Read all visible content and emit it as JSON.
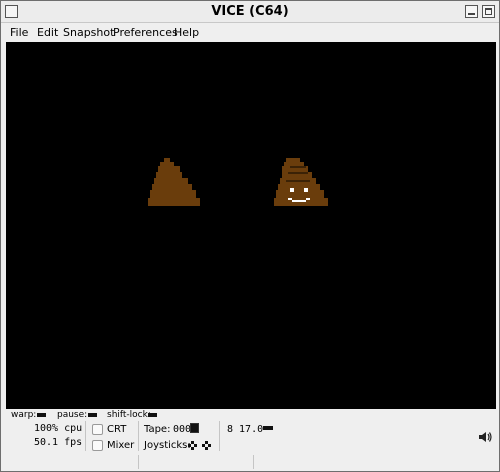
{
  "window": {
    "title": "VICE (C64)"
  },
  "menu": {
    "items": [
      "File",
      "Edit",
      "Snapshot",
      "Preferences",
      "Help"
    ]
  },
  "status": {
    "warp_label": "warp:",
    "pause_label": "pause:",
    "shift_lock_label": "shift-lock:",
    "cpu": "100% cpu",
    "fps": "50.1 fps",
    "crt_label": "CRT",
    "mixer_label": "Mixer",
    "tape_label": "Tape:",
    "tape_counter": "000",
    "joysticks_label": "Joysticks:",
    "drive_status": "8 17.0"
  },
  "colors": {
    "screen_background": "#000000",
    "sprite_brown": "#6a3d0c",
    "sprite_dark_stripe": "#3b2206",
    "window_background": "#efefef"
  },
  "icons": {
    "volume": "speaker-icon"
  }
}
